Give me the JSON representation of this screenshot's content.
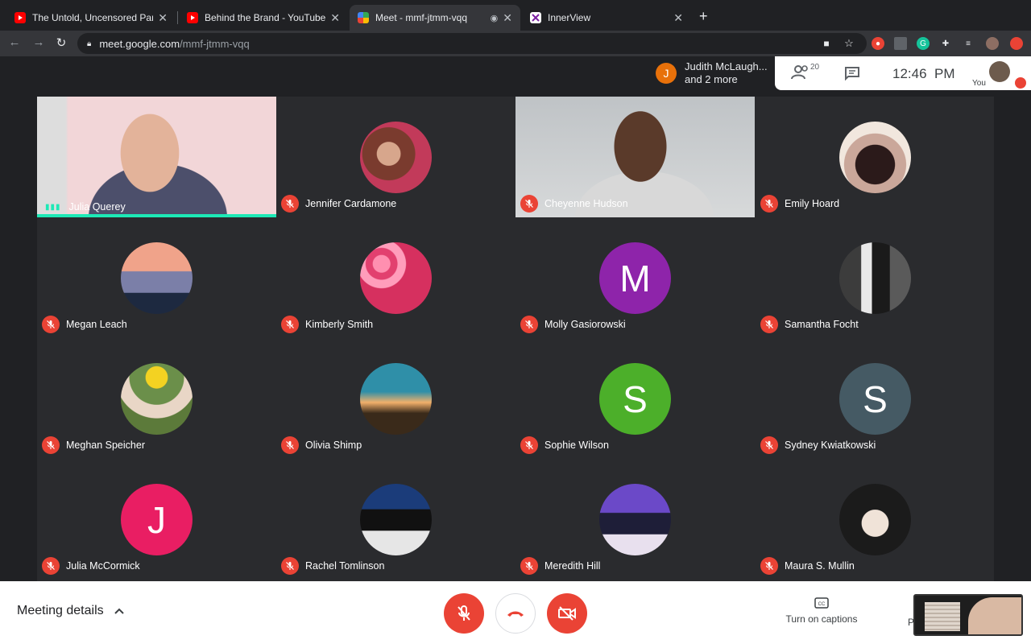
{
  "browser": {
    "tabs": [
      {
        "title": "The Untold, Uncensored Paran",
        "icon": "youtube-icon",
        "active": false
      },
      {
        "title": "Behind the Brand - YouTube",
        "icon": "youtube-icon",
        "active": false
      },
      {
        "title": "Meet - mmf-jtmm-vqq",
        "icon": "meet-icon",
        "active": true
      },
      {
        "title": "InnerView",
        "icon": "innerview-icon",
        "active": false
      }
    ],
    "url_host": "meet.google.com",
    "url_path": "/mmf-jtmm-vqq"
  },
  "meet": {
    "presenting": {
      "initial": "J",
      "line1": "Judith McLaugh...",
      "line2": "and 2 more"
    },
    "participant_count": "20",
    "time": "12:46  PM",
    "you_label": "You",
    "participants": [
      {
        "name": "Julia Querey",
        "kind": "video",
        "speaking": true
      },
      {
        "name": "Jennifer Cardamone",
        "kind": "photo",
        "muted": true
      },
      {
        "name": "Cheyenne Hudson",
        "kind": "video",
        "muted": true
      },
      {
        "name": "Emily Hoard",
        "kind": "photo",
        "muted": true
      },
      {
        "name": "Megan Leach",
        "kind": "photo",
        "muted": true
      },
      {
        "name": "Kimberly Smith",
        "kind": "photo",
        "muted": true
      },
      {
        "name": "Molly Gasiorowski",
        "kind": "initial",
        "initial": "M",
        "color": "#8e24aa",
        "muted": true
      },
      {
        "name": "Samantha Focht",
        "kind": "photo",
        "muted": true
      },
      {
        "name": "Meghan Speicher",
        "kind": "photo",
        "muted": true
      },
      {
        "name": "Olivia Shimp",
        "kind": "photo",
        "muted": true
      },
      {
        "name": "Sophie Wilson",
        "kind": "initial",
        "initial": "S",
        "color": "#4caf2a",
        "muted": true
      },
      {
        "name": "Sydney Kwiatkowski",
        "kind": "initial",
        "initial": "S",
        "color": "#455a64",
        "muted": true
      },
      {
        "name": "Julia McCormick",
        "kind": "initial",
        "initial": "J",
        "color": "#e91e63",
        "muted": true
      },
      {
        "name": "Rachel Tomlinson",
        "kind": "photo",
        "muted": true
      },
      {
        "name": "Meredith Hill",
        "kind": "photo",
        "muted": true
      },
      {
        "name": "Maura S. Mullin",
        "kind": "photo",
        "muted": true
      }
    ],
    "bottom": {
      "meeting_details": "Meeting details",
      "captions": "Turn on captions",
      "present_partial": "P"
    },
    "colors": {
      "end_call": "#ea4335",
      "speaking": "#1de9b6"
    }
  }
}
